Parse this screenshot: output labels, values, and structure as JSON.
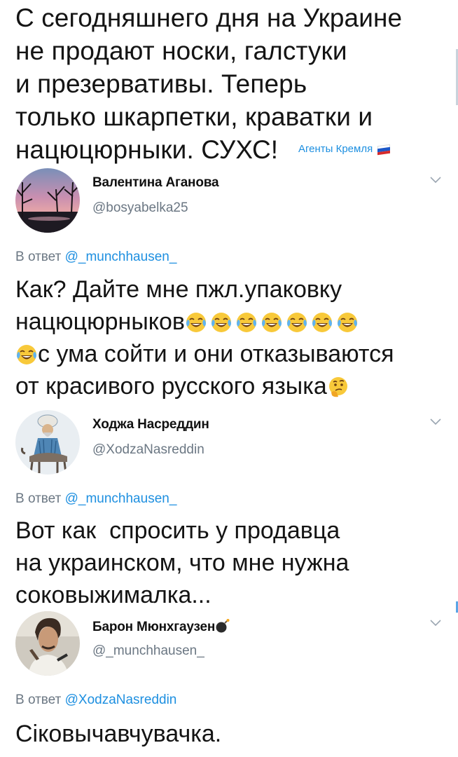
{
  "top_post": {
    "lines": [
      "С сегодняшнего дня на Украине",
      "не продают носки, галстуки",
      "и презервативы. Теперь",
      "только шкарпетки, краватки и",
      "нацюцюрныки. СУХС!"
    ],
    "signature": "Агенты Кремля",
    "flag_colors": [
      "#ffffff",
      "#1c57c8",
      "#d62b2b"
    ]
  },
  "tweets": [
    {
      "name": "Валентина Аганова",
      "handle": "@bosyabelka25",
      "reply_label": "В ответ",
      "reply_mention": "@_munchhausen_",
      "lines": [
        "Как? Дайте мне пжл.упаковку",
        "нацюцюрныков",
        "с ума сойти и они отказываются",
        "от красивого русского языка"
      ],
      "emoji_line1": [
        "face-with-tears-of-joy-icon",
        "face-with-tears-of-joy-icon",
        "face-with-tears-of-joy-icon",
        "face-with-tears-of-joy-icon",
        "face-with-tears-of-joy-icon",
        "face-with-tears-of-joy-icon",
        "face-with-tears-of-joy-icon"
      ],
      "emoji_line2": [
        "face-with-tears-of-joy-icon"
      ],
      "emoji_line3": [
        "thinking-face-icon"
      ]
    },
    {
      "name": "Ходжа Насреддин",
      "handle": "@XodzaNasreddin",
      "reply_label": "В ответ",
      "reply_mention": "@_munchhausen_",
      "lines": [
        "Вот как  спросить у продавца",
        "на украинском, что мне нужна",
        "соковыжималка..."
      ]
    },
    {
      "name": "Барон Мюнхгаузен",
      "name_icon": "bomb-icon",
      "handle": "@_munchhausen_",
      "reply_label": "В ответ",
      "reply_mention": "@XodzaNasreddin",
      "lines": [
        "Сiковычавчувачка."
      ]
    }
  ],
  "icons": {
    "tweet_menu": "chevron-down-icon"
  },
  "colors": {
    "link": "#1d8fe0",
    "secondary_text": "#6b7783",
    "text": "#141414"
  }
}
